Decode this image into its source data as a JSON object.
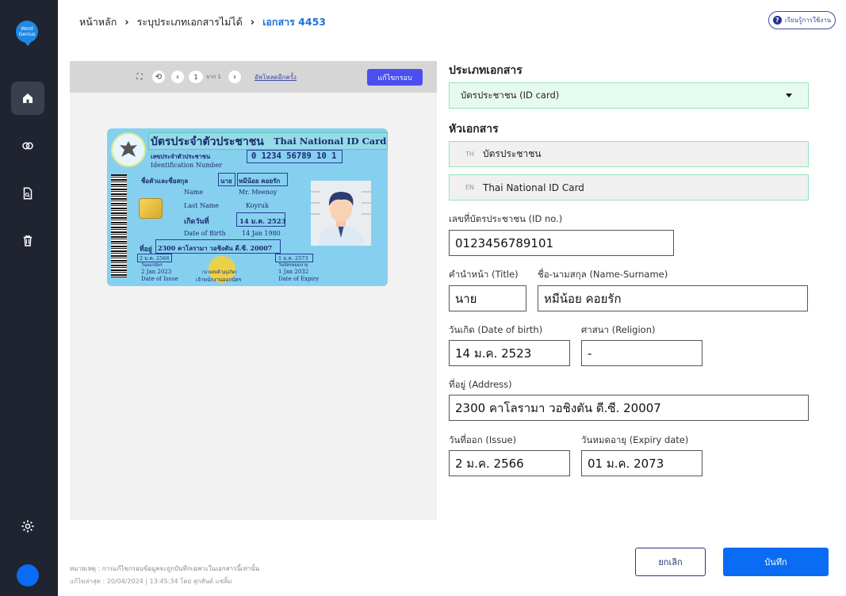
{
  "app": {
    "logo_text": "Word Genius"
  },
  "sidebar": {
    "items": [
      {
        "name": "home",
        "icon": "home-icon",
        "active": true
      },
      {
        "name": "link",
        "icon": "link-icon",
        "active": false
      },
      {
        "name": "document",
        "icon": "document-icon",
        "active": false
      },
      {
        "name": "trash",
        "icon": "trash-icon",
        "active": false
      }
    ],
    "settings_icon": "gear-icon"
  },
  "breadcrumb": {
    "home": "หน้าหลัก",
    "middle": "ระบุประเภทเอกสารไม่ได้",
    "current": "เอกสาร 4453"
  },
  "help_button": {
    "label": "เรียนรู้การใช้งาน",
    "icon": "?"
  },
  "viewer": {
    "page_current": "1",
    "page_of": "จาก 1",
    "upload_link": "อัพโหลดอีกครั้ง",
    "edit_button": "แก้ไขกรอบ"
  },
  "id_card": {
    "title_th": "บัตรประจำตัวประชาชน",
    "title_en": "Thai National ID Card",
    "id_label_th": "เลขประจำตัวประชาชน",
    "id_label_en": "Identification Number",
    "id_number": "0 1234 56789 10 1",
    "name_label_th": "ชื่อตัวและชื่อสกุล",
    "title_th_val": "นาย",
    "name_th_val": "หมีน้อย คอยรัก",
    "name_label_en": "Name",
    "name_en_val": "Mr. Meenoy",
    "lastname_label_en": "Last Name",
    "lastname_en_val": "Koyruk",
    "dob_label_th": "เกิดวันที่",
    "dob_th_val": "14 ม.ค. 2523",
    "dob_label_en": "Date of Birth",
    "dob_en_val": "14 Jan 1980",
    "address_label": "ที่อยู่",
    "address_val": "2300 คาโลรามา วอชิงตัน ดี.ซี. 20007",
    "issue_th": "2 ม.ค. 2566",
    "issue_label_th": "วันออกบัตร",
    "issue_en": "2 Jan 2023",
    "issue_label_en": "Date of Issue",
    "officer_name": "(นายสมดี บุญเกิด)",
    "officer_title": "เจ้าพนักงานออกบัตร",
    "expiry_th": "1 ม.ค. 2573",
    "expiry_label_th": "วันบัตรหมดอายุ",
    "expiry_en": "1 Jan 2032",
    "expiry_label_en": "Date of Expiry"
  },
  "form": {
    "doc_type_title": "ประเภทเอกสาร",
    "doc_type_value": "บัตรประชาชน (ID card)",
    "header_title": "หัวเอกสาร",
    "header_th_lang": "TH",
    "header_th_value": "บัตรประชาชน",
    "header_en_lang": "EN",
    "header_en_value": "Thai National ID Card",
    "id_label": "เลขที่บัตรประชาชน (ID no.)",
    "id_value": "0123456789101",
    "title_label": "คำนำหน้า (Title)",
    "title_value": "นาย",
    "name_label": "ชื่อ-นามสกุล (Name-Surname)",
    "name_value": "หมีน้อย คอยรัก",
    "dob_label": "วันเกิด (Date of birth)",
    "dob_value": "14 ม.ค. 2523",
    "religion_label": "ศาสนา (Religion)",
    "religion_value": "-",
    "address_label": "ที่อยู่ (Address)",
    "address_value": "2300 คาโลรามา วอชิงตัน ดี.ซี. 20007",
    "issue_label": "วันที่ออก (Issue)",
    "issue_value": "2 ม.ค. 2566",
    "expiry_label": "วันหมดอายุ (Expiry date)",
    "expiry_value": "01 ม.ค. 2073"
  },
  "footer": {
    "note": "หมายเหตุ : การแก้ไขกรอบข้อมูลจะถูกบันทึกเฉพาะในเอกสารนี้เท่านั้น",
    "last_edit": "แก้ไขล่าสุด : 20/04/2024 | 13:45:34 โดย สุกสันต์ แซ่ลิ้ม",
    "cancel_label": "ยกเลิก",
    "save_label": "บันทึก"
  },
  "colors": {
    "sidebar": "#1f2430",
    "accent": "#0a6cf5",
    "field_highlight": "#8ee7b6",
    "breadcrumb_current": "#1e6fd9"
  }
}
